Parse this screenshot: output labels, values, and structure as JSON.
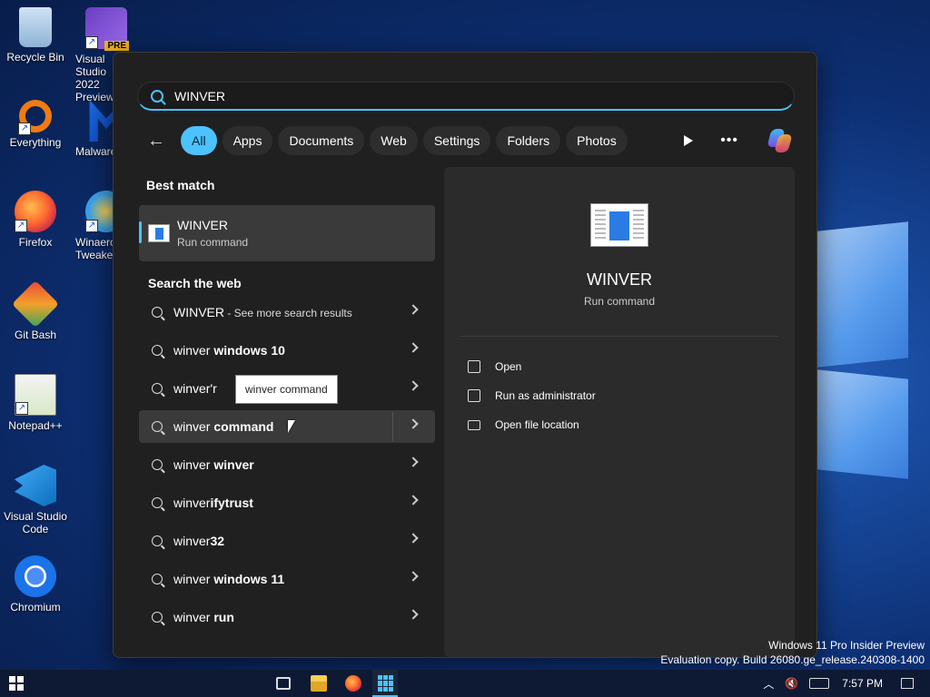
{
  "desktop": {
    "icons": [
      {
        "label": "Recycle Bin",
        "icon": "recycle-bin-icon"
      },
      {
        "label": "Visual Studio\n2022 Preview",
        "icon": "visual-studio-preview-icon",
        "badge": "PRE"
      },
      {
        "label": "Everything",
        "icon": "everything-search-icon"
      },
      {
        "label": "Malwarebytes",
        "icon": "malwarebytes-icon"
      },
      {
        "label": "Firefox",
        "icon": "firefox-icon"
      },
      {
        "label": "Winaero Tweaker",
        "icon": "winaero-tweaker-icon"
      },
      {
        "label": "Git Bash",
        "icon": "git-bash-icon"
      },
      {
        "label": "Notepad++",
        "icon": "notepad-plus-plus-icon"
      },
      {
        "label": "Visual Studio Code",
        "icon": "vscode-icon"
      },
      {
        "label": "Chromium",
        "icon": "chromium-icon"
      }
    ],
    "watermark_line1": "Windows 11 Pro Insider Preview",
    "watermark_line2": "Evaluation copy. Build 26080.ge_release.240308-1400"
  },
  "search": {
    "query": "WINVER",
    "filters": [
      "All",
      "Apps",
      "Documents",
      "Web",
      "Settings",
      "Folders",
      "Photos"
    ],
    "active_filter": "All"
  },
  "best_match": {
    "title": "Best match",
    "name": "WINVER",
    "type": "Run command"
  },
  "web": {
    "title": "Search the web",
    "items": [
      {
        "normal": "WINVER",
        "bold": "",
        "suffix": " - See more search results"
      },
      {
        "normal": "winver",
        "bold": " windows 10",
        "suffix": ""
      },
      {
        "normal": "winver",
        "bold": "'r",
        "suffix": ""
      },
      {
        "normal": "winver",
        "bold": " command",
        "suffix": ""
      },
      {
        "normal": "winver",
        "bold": " winver",
        "suffix": ""
      },
      {
        "normal": "winver",
        "bold": "ifytrust",
        "suffix": ""
      },
      {
        "normal": "winver",
        "bold": "32",
        "suffix": ""
      },
      {
        "normal": "winver",
        "bold": " windows 11",
        "suffix": ""
      },
      {
        "normal": "winver",
        "bold": " run",
        "suffix": ""
      }
    ],
    "tooltip": "winver command"
  },
  "detail": {
    "name": "WINVER",
    "type": "Run command",
    "actions": [
      {
        "label": "Open",
        "icon": "open-external-icon"
      },
      {
        "label": "Run as administrator",
        "icon": "shield-admin-icon"
      },
      {
        "label": "Open file location",
        "icon": "folder-icon"
      }
    ]
  },
  "taskbar": {
    "time": "7:57 PM",
    "apps": [
      "task-view-icon",
      "file-explorer-icon",
      "firefox-icon",
      "search-app-icon"
    ]
  }
}
